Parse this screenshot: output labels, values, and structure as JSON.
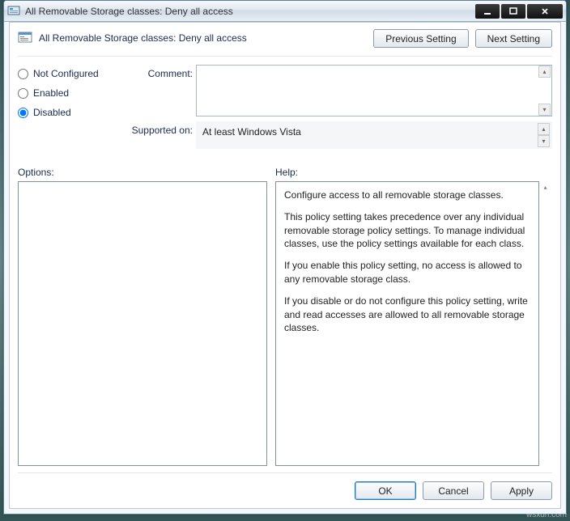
{
  "window": {
    "title": "All Removable Storage classes: Deny all access"
  },
  "setting": {
    "title": "All Removable Storage classes: Deny all access"
  },
  "nav": {
    "prev": "Previous Setting",
    "next": "Next Setting"
  },
  "radios": {
    "not_configured": "Not Configured",
    "enabled": "Enabled",
    "disabled": "Disabled",
    "selected": "disabled"
  },
  "labels": {
    "comment": "Comment:",
    "supported": "Supported on:",
    "options": "Options:",
    "help": "Help:"
  },
  "comment": "",
  "supported_text": "At least Windows Vista",
  "help": {
    "p1": "Configure access to all removable storage classes.",
    "p2": "This policy setting takes precedence over any individual removable storage policy settings. To manage individual classes, use the policy settings available for each class.",
    "p3": "If you enable this policy setting, no access is allowed to any removable storage class.",
    "p4": "If you disable or do not configure this policy setting, write and read accesses are allowed to all removable storage classes."
  },
  "footer": {
    "ok": "OK",
    "cancel": "Cancel",
    "apply": "Apply"
  },
  "watermark": "wsxdn.com"
}
